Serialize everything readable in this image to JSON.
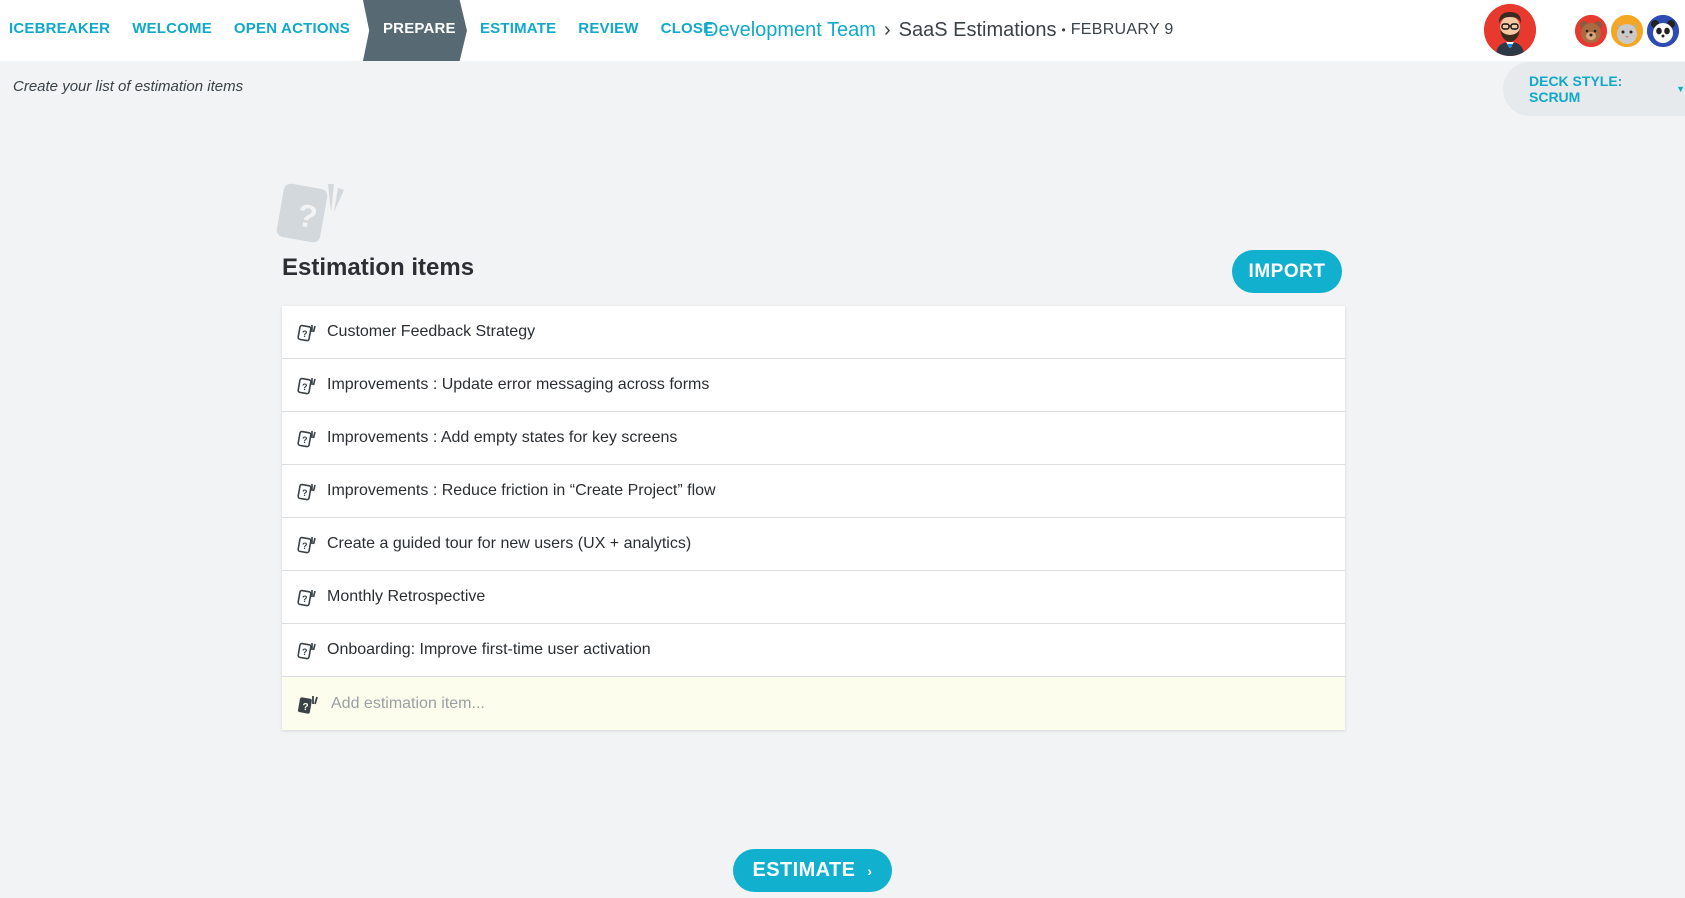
{
  "nav": {
    "steps": [
      "ICEBREAKER",
      "WELCOME",
      "OPEN ACTIONS",
      "PREPARE",
      "ESTIMATE",
      "REVIEW",
      "CLOSE"
    ],
    "active_step": "PREPARE"
  },
  "breadcrumb": {
    "team": "Development Team",
    "board": "SaaS Estimations",
    "date": "FEBRUARY 9"
  },
  "user": {
    "avatar_icon": "hipster-avatar-icon"
  },
  "team_avatars": [
    "bear-avatar-icon",
    "cat-avatar-icon",
    "panda-avatar-icon"
  ],
  "subheader": {
    "instruction": "Create your list of estimation items",
    "deck_style_label": "DECK STYLE: SCRUM"
  },
  "main": {
    "title": "Estimation items",
    "import_label": "IMPORT",
    "items": [
      "Customer Feedback Strategy",
      "Improvements : Update error messaging across forms",
      "Improvements : Add empty states for key screens",
      "Improvements : Reduce friction in “Create Project” flow",
      "Create a guided tour for new users (UX + analytics)",
      "Monthly Retrospective",
      "Onboarding: Improve first-time user activation"
    ],
    "add_placeholder": "Add estimation item..."
  },
  "footer": {
    "estimate_label": "ESTIMATE"
  },
  "colors": {
    "accent": "#11b0cf",
    "active_step": "#576a73",
    "background": "#f1f3f4"
  }
}
